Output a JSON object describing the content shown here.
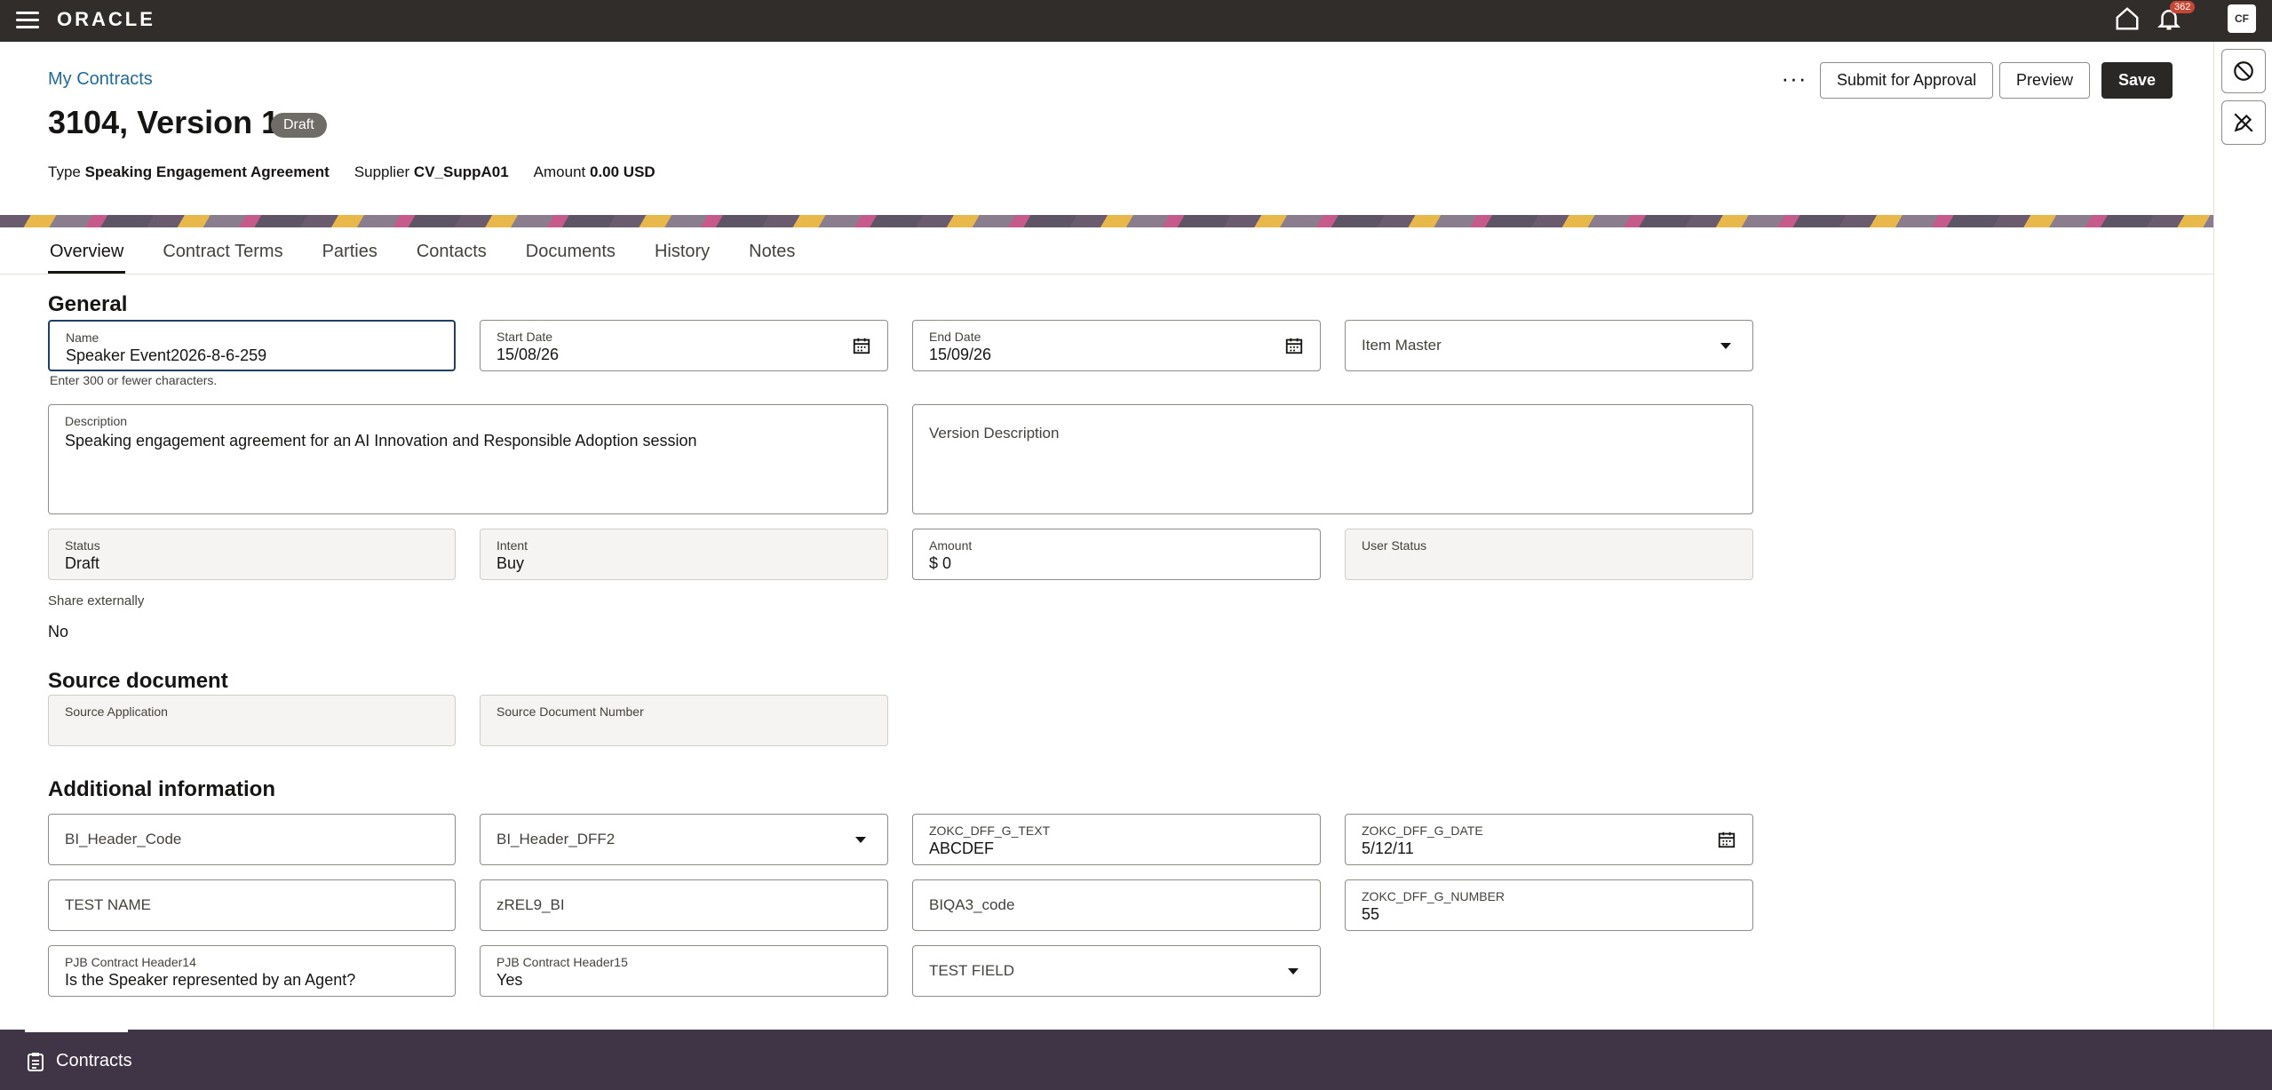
{
  "topbar": {
    "logo": "ORACLE",
    "notification_count": "362",
    "avatar_initials": "CF"
  },
  "header": {
    "breadcrumb": "My Contracts",
    "title": "3104, Version 1",
    "status_badge": "Draft",
    "meta": {
      "type_label": "Type",
      "type_value": "Speaking Engagement Agreement",
      "supplier_label": "Supplier",
      "supplier_value": "CV_SuppA01",
      "amount_label": "Amount",
      "amount_value": "0.00 USD"
    },
    "more": "···",
    "submit_label": "Submit for Approval",
    "preview_label": "Preview",
    "save_label": "Save"
  },
  "tabs": [
    "Overview",
    "Contract Terms",
    "Parties",
    "Contacts",
    "Documents",
    "History",
    "Notes"
  ],
  "general": {
    "title": "General",
    "name_label": "Name",
    "name_value": "Speaker Event2026-8-6-259",
    "name_helper": "Enter 300 or fewer characters.",
    "start_label": "Start Date",
    "start_value": "15/08/26",
    "end_label": "End Date",
    "end_value": "15/09/26",
    "item_master": "Item Master",
    "description_label": "Description",
    "description_value": "Speaking engagement agreement for an AI Innovation and Responsible Adoption session",
    "version_description": "Version Description",
    "status_label": "Status",
    "status_value": "Draft",
    "intent_label": "Intent",
    "intent_value": "Buy",
    "amount_label": "Amount",
    "amount_value": "$ 0",
    "user_status_label": "User Status",
    "share_label": "Share externally",
    "share_value": "No"
  },
  "source": {
    "title": "Source document",
    "app_label": "Source Application",
    "number_label": "Source Document Number"
  },
  "additional": {
    "title": "Additional information",
    "bi_header_code": "BI_Header_Code",
    "bi_header_dff2": "BI_Header_DFF2",
    "g_text_label": "ZOKC_DFF_G_TEXT",
    "g_text_value": "ABCDEF",
    "g_date_label": "ZOKC_DFF_G_DATE",
    "g_date_value": "5/12/11",
    "test_name": "TEST NAME",
    "zrel9": "zREL9_BI",
    "biqa3": "BIQA3_code",
    "g_number_label": "ZOKC_DFF_G_NUMBER",
    "g_number_value": "55",
    "h14_label": "PJB Contract Header14",
    "h14_value": "Is the Speaker represented by an Agent?",
    "h15_label": "PJB Contract Header15",
    "h15_value": "Yes",
    "test_field": "TEST FIELD"
  },
  "footer": {
    "label": "Contracts"
  }
}
